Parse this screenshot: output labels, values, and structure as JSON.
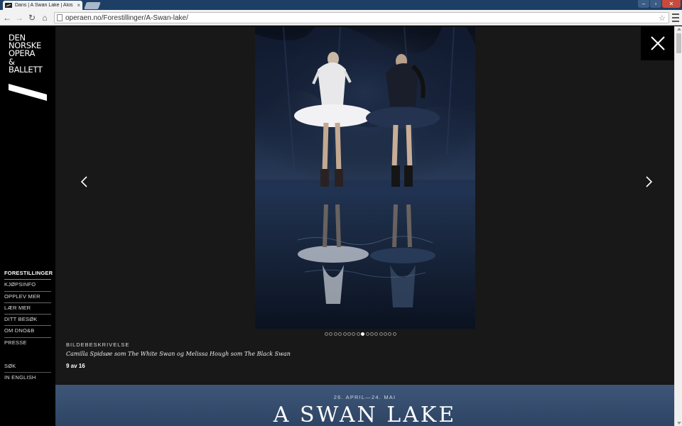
{
  "browser": {
    "tab_title": "Dans | A Swan Lake | Alos",
    "tab_close": "×",
    "url": "operaen.no/Forestillinger/A-Swan-lake/",
    "window_controls": {
      "minimize": "–",
      "maximize": "▫",
      "close": "✕"
    },
    "nav": {
      "back": "←",
      "forward": "→",
      "reload": "↻",
      "home": "⌂",
      "star": "☆"
    }
  },
  "sidebar": {
    "logo_lines": [
      "DEN",
      "NORSKE",
      "OPERA",
      "&",
      "BALLETT"
    ],
    "nav_items": [
      {
        "label": "FORESTILLINGER",
        "active": true
      },
      {
        "label": "KJØPSINFO"
      },
      {
        "label": "OPPLEV MER"
      },
      {
        "label": "LÆR MER"
      },
      {
        "label": "DITT BESØK"
      },
      {
        "label": "OM DNO&B"
      },
      {
        "label": "PRESSE"
      }
    ],
    "extra_items": [
      {
        "label": "SØK"
      },
      {
        "label": "IN ENGLISH"
      }
    ]
  },
  "lightbox": {
    "caption_label": "BILDEBESKRIVELSE",
    "caption_text": "Camilla Spidsøe som The White Swan og Melissa Hough som The Black Swan",
    "counter": "9 av 16",
    "total_images": 16,
    "current_index": 9,
    "icons": {
      "prev": "chevron-left-icon",
      "next": "chevron-right-icon",
      "close": "close-icon"
    }
  },
  "hero": {
    "date": "26. APRIL—24. MAI",
    "title": "A SWAN LAKE"
  },
  "colors": {
    "page_bg": "#181818",
    "sidebar_bg": "#000000",
    "hero_bg": "#3d5678",
    "tabstrip": "#1d3f66"
  }
}
